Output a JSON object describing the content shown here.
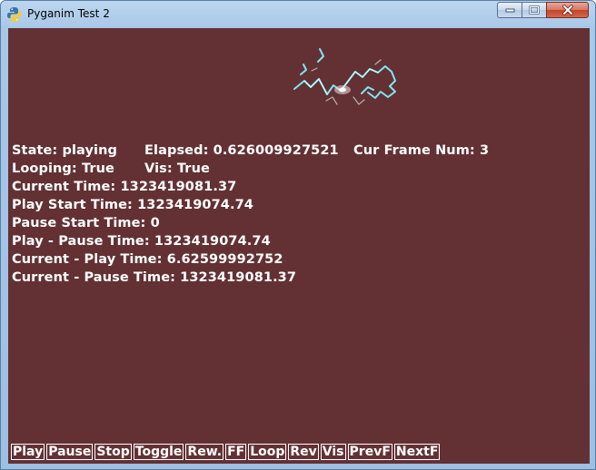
{
  "window": {
    "title": "Pyganim Test 2",
    "icon": "python-snake-icon",
    "background_color": "#633134"
  },
  "caption": {
    "minimize": "minimize-icon",
    "maximize": "maximize-icon",
    "close": "close-icon"
  },
  "status": {
    "state": "State: playing",
    "elapsed": "Elapsed: 0.626009927521",
    "frame": "Cur Frame Num: 3",
    "looping": "Looping: True",
    "vis": "Vis: True",
    "current_time": "Current Time: 1323419081.37",
    "play_start": "Play Start Time: 1323419074.74",
    "pause_start": "Pause Start Time: 0",
    "play_minus_pause": "Play - Pause Time: 1323419074.74",
    "current_minus_play": "Current - Play Time: 6.62599992752",
    "current_minus_pause": "Current - Pause Time: 1323419081.37"
  },
  "controls": [
    "Play",
    "Pause",
    "Stop",
    "Toggle",
    "Rew.",
    "FF",
    "Loop",
    "Rev",
    "Vis",
    "PrevF",
    "NextF"
  ],
  "animation": {
    "sprite": "lightning-spark-animation",
    "color": "#aef2f7"
  }
}
